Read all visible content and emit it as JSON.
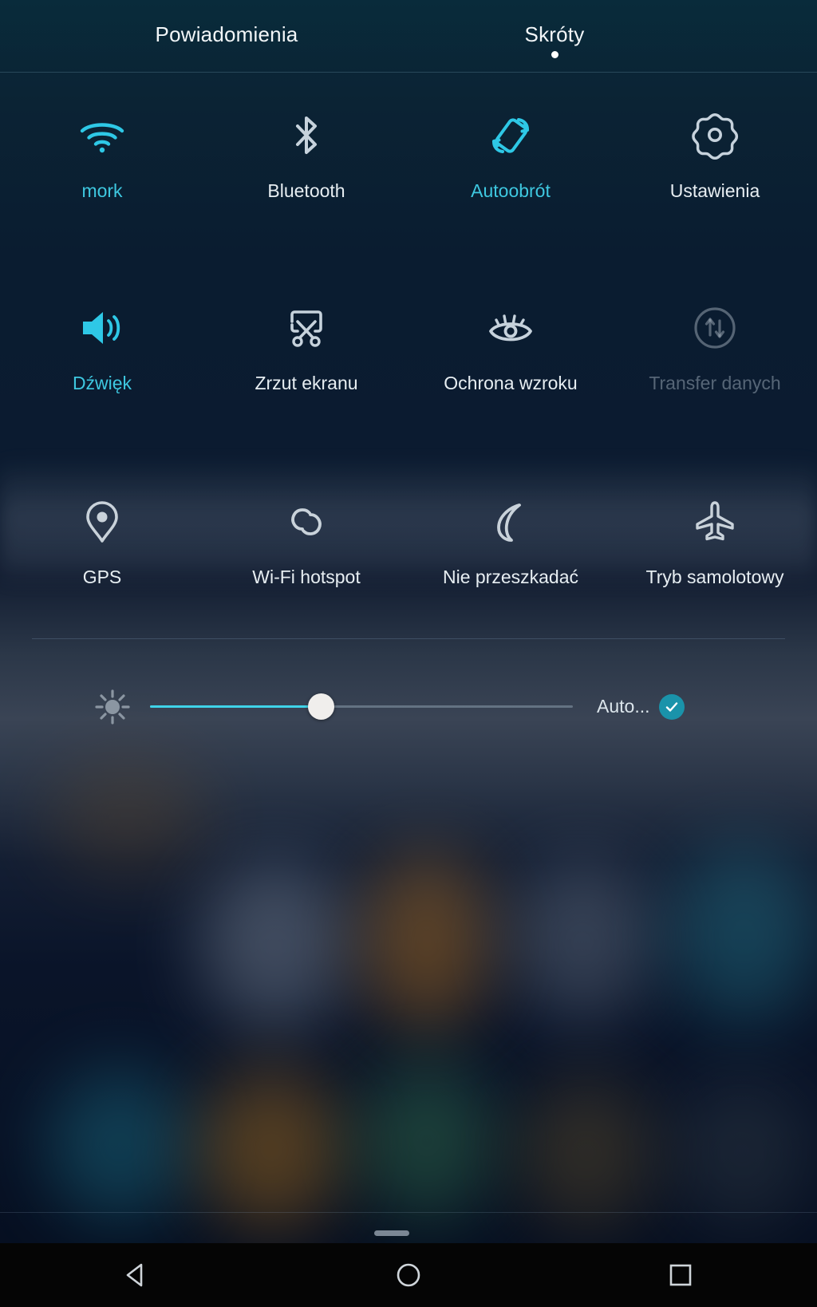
{
  "header": {
    "tabs": [
      {
        "label": "Powiadomienia",
        "active": false
      },
      {
        "label": "Skróty",
        "active": true
      }
    ]
  },
  "quick_settings": {
    "rows": [
      [
        {
          "label": "mork",
          "icon": "wifi-icon",
          "state": "on"
        },
        {
          "label": "Bluetooth",
          "icon": "bluetooth-icon",
          "state": "off"
        },
        {
          "label": "Autoobrót",
          "icon": "auto-rotate-icon",
          "state": "on"
        },
        {
          "label": "Ustawienia",
          "icon": "gear-icon",
          "state": "off"
        }
      ],
      [
        {
          "label": "Dźwięk",
          "icon": "speaker-icon",
          "state": "on"
        },
        {
          "label": "Zrzut ekranu",
          "icon": "screenshot-icon",
          "state": "off"
        },
        {
          "label": "Ochrona wzroku",
          "icon": "eye-icon",
          "state": "off"
        },
        {
          "label": "Transfer danych",
          "icon": "data-transfer-icon",
          "state": "disabled"
        }
      ],
      [
        {
          "label": "GPS",
          "icon": "location-pin-icon",
          "state": "off"
        },
        {
          "label": "Wi-Fi hotspot",
          "icon": "hotspot-icon",
          "state": "off"
        },
        {
          "label": "Nie przeszkadać",
          "icon": "moon-icon",
          "state": "off"
        },
        {
          "label": "Tryb samolotowy",
          "icon": "airplane-icon",
          "state": "off"
        }
      ]
    ]
  },
  "brightness": {
    "icon": "brightness-icon",
    "value_percent": 40,
    "auto_label": "Auto...",
    "auto_enabled": true,
    "check_icon": "check-icon"
  },
  "navbar": {
    "buttons": [
      {
        "name": "back",
        "icon": "back-triangle-icon"
      },
      {
        "name": "home",
        "icon": "home-circle-icon"
      },
      {
        "name": "recents",
        "icon": "recents-square-icon"
      }
    ]
  },
  "colors": {
    "accent_cyan": "#2ec8e6",
    "label_default": "#e7eef2",
    "label_disabled": "rgba(190,206,218,.42)",
    "auto_check_bg": "#1a93aa",
    "panel_bg": "#061024"
  }
}
